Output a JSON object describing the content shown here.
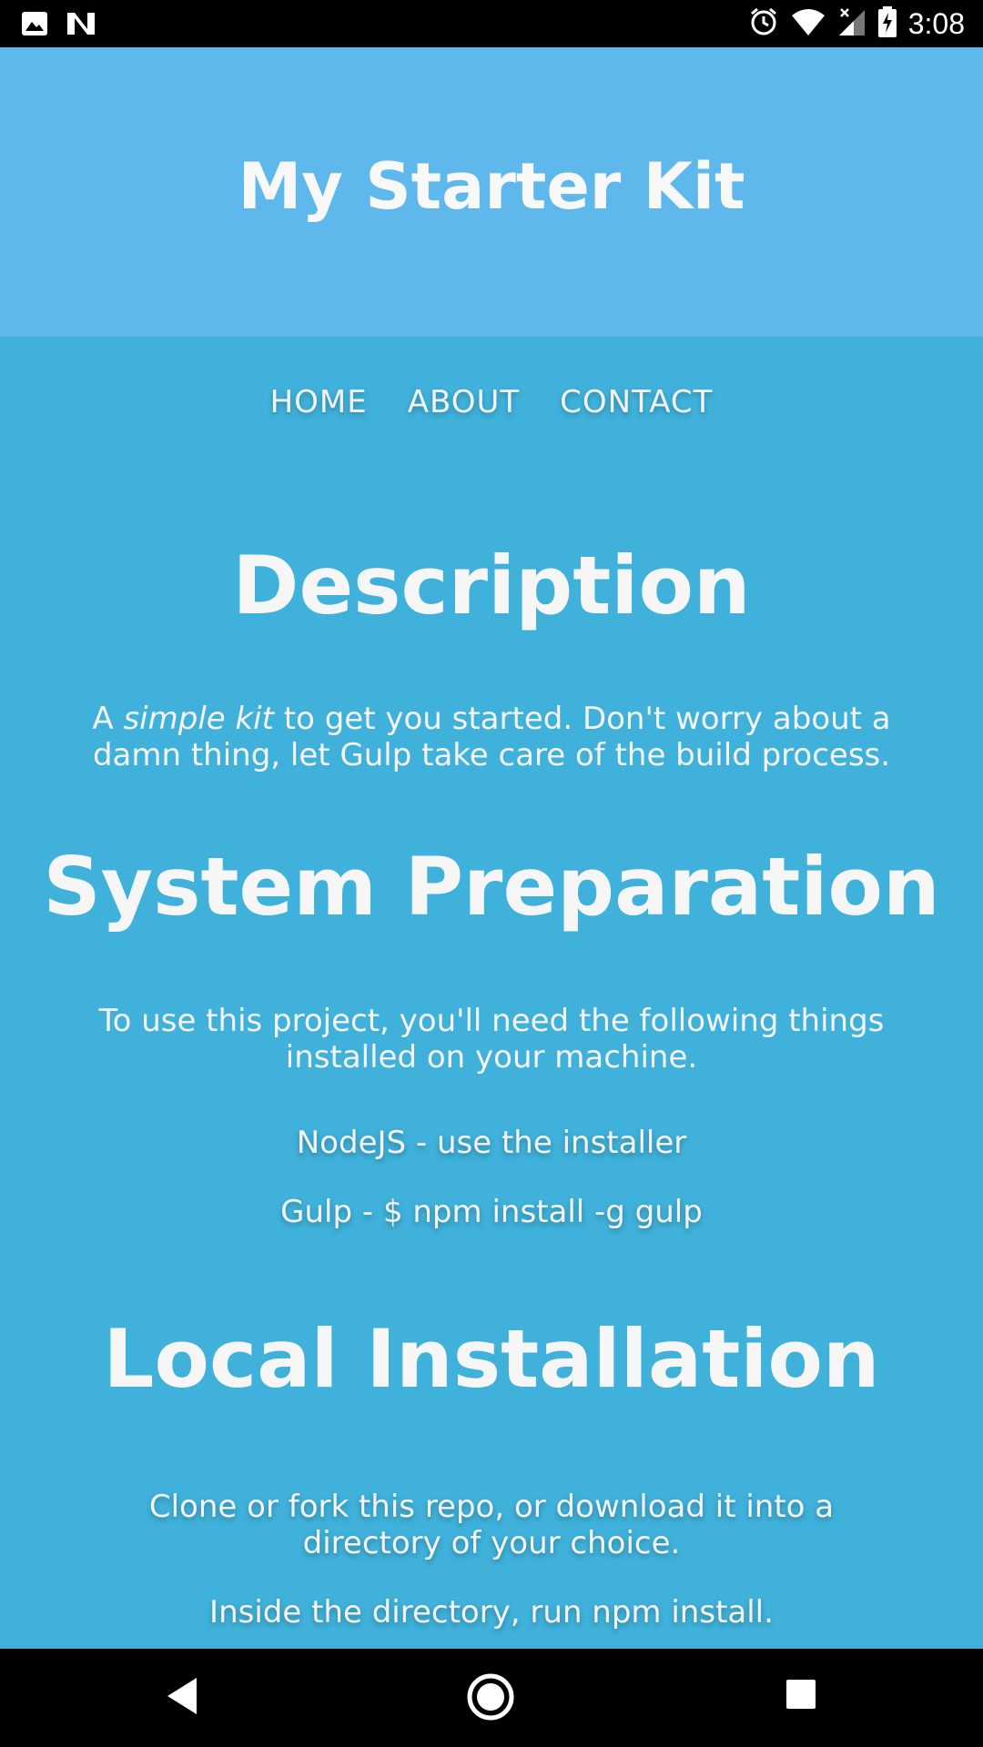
{
  "status_bar": {
    "time": "3:08",
    "left_icons": [
      "image-icon",
      "n-logo-icon"
    ],
    "right_icons": [
      "alarm-icon",
      "wifi-icon",
      "signal-icon",
      "battery-charging-icon"
    ]
  },
  "header": {
    "title": "My Starter Kit"
  },
  "nav": {
    "items": [
      {
        "label": "HOME"
      },
      {
        "label": "ABOUT"
      },
      {
        "label": "CONTACT"
      }
    ]
  },
  "sections": {
    "description": {
      "title": "Description",
      "text_a": "A ",
      "text_em": "simple kit",
      "text_b": " to get you started. Don't worry about a damn thing, let Gulp take care of the build process."
    },
    "system_prep": {
      "title": "System Preparation",
      "text": "To use this project, you'll need the following things installed on your machine.",
      "items": [
        {
          "label": "NodeJS - use the installer"
        },
        {
          "label": "Gulp - $ npm install -g gulp"
        }
      ]
    },
    "local_install": {
      "title": "Local Installation",
      "text1": "Clone or fork this repo, or download it into a directory of your choice.",
      "text2": "Inside the directory, run npm install."
    }
  },
  "system_nav": {
    "buttons": [
      "back-icon",
      "home-circle-icon",
      "recents-square-icon"
    ]
  },
  "colors": {
    "header_bg": "#5fb8eb",
    "main_bg": "#3fb1da",
    "text": "#f6f6f6"
  }
}
